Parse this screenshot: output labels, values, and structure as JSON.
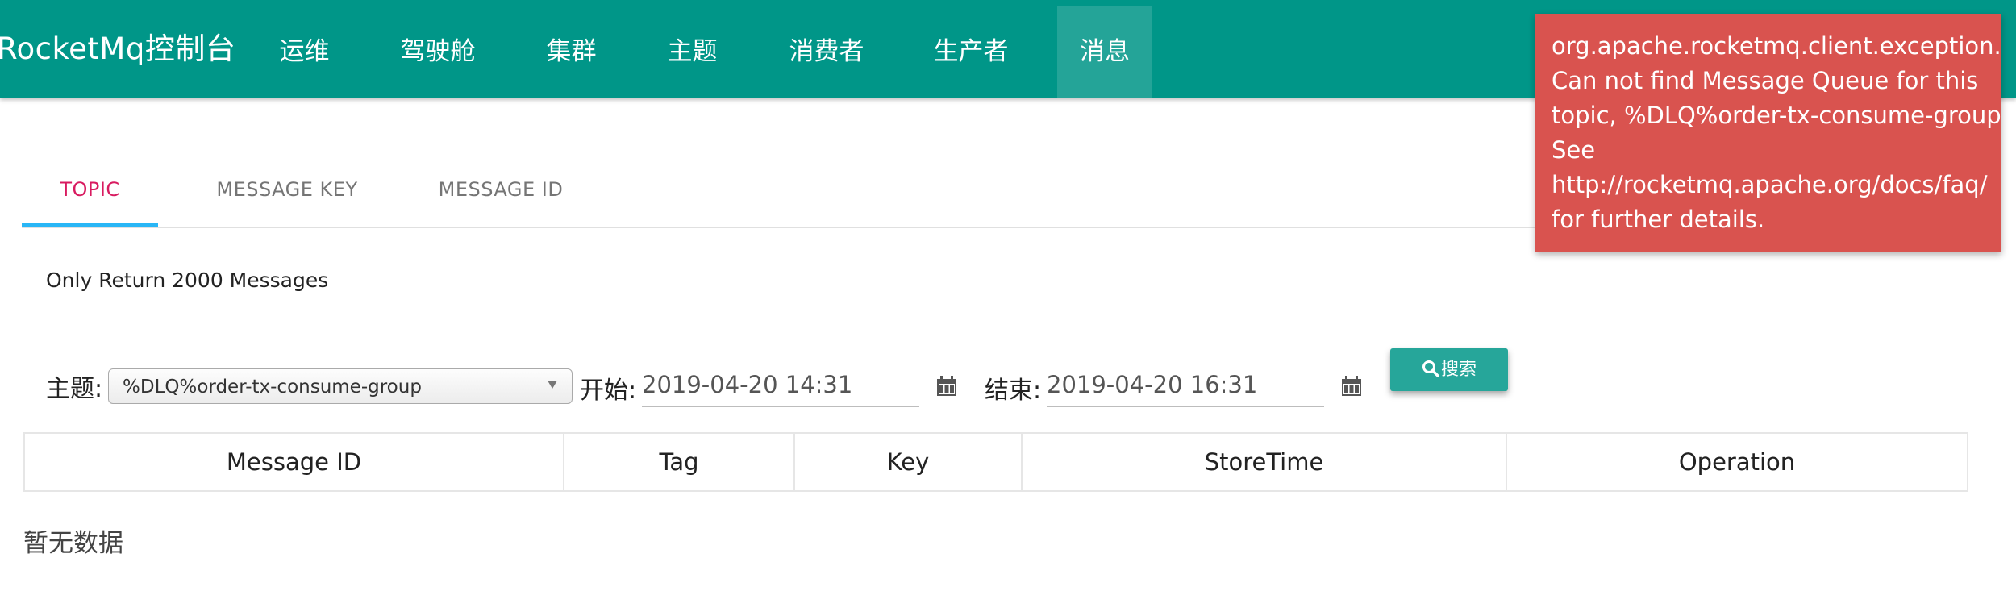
{
  "app": {
    "brand": "RocketMq控制台"
  },
  "nav": {
    "items": [
      {
        "label": "运维"
      },
      {
        "label": "驾驶舱"
      },
      {
        "label": "集群"
      },
      {
        "label": "主题"
      },
      {
        "label": "消费者"
      },
      {
        "label": "生产者"
      },
      {
        "label": "消息"
      }
    ],
    "active": "消息"
  },
  "tabs": [
    {
      "label": "TOPIC"
    },
    {
      "label": "MESSAGE KEY"
    },
    {
      "label": "MESSAGE ID"
    }
  ],
  "notice": "Only Return 2000 Messages",
  "filters": {
    "topic_label": "主题:",
    "topic_value": "%DLQ%order-tx-consume-group",
    "start_label": "开始:",
    "start_value": "2019-04-20 14:31",
    "end_label": "结束:",
    "end_value": "2019-04-20 16:31",
    "search_label": "搜索"
  },
  "table": {
    "columns": [
      "Message ID",
      "Tag",
      "Key",
      "StoreTime",
      "Operation"
    ],
    "empty_text": "暂无数据"
  },
  "toast": {
    "lines": [
      "org.apache.rocketmq.client.exception.MQClientException:",
      "Can not find Message Queue for this",
      "topic, %DLQ%order-tx-consume-group",
      "See",
      "http://rocketmq.apache.org/docs/faq/",
      "for further details."
    ]
  },
  "colors": {
    "navbar": "#009688",
    "tab_active_text": "#d81b60",
    "tab_indicator": "#29b6f6",
    "search_button": "#26a69a",
    "toast_error": "#d9534f"
  }
}
